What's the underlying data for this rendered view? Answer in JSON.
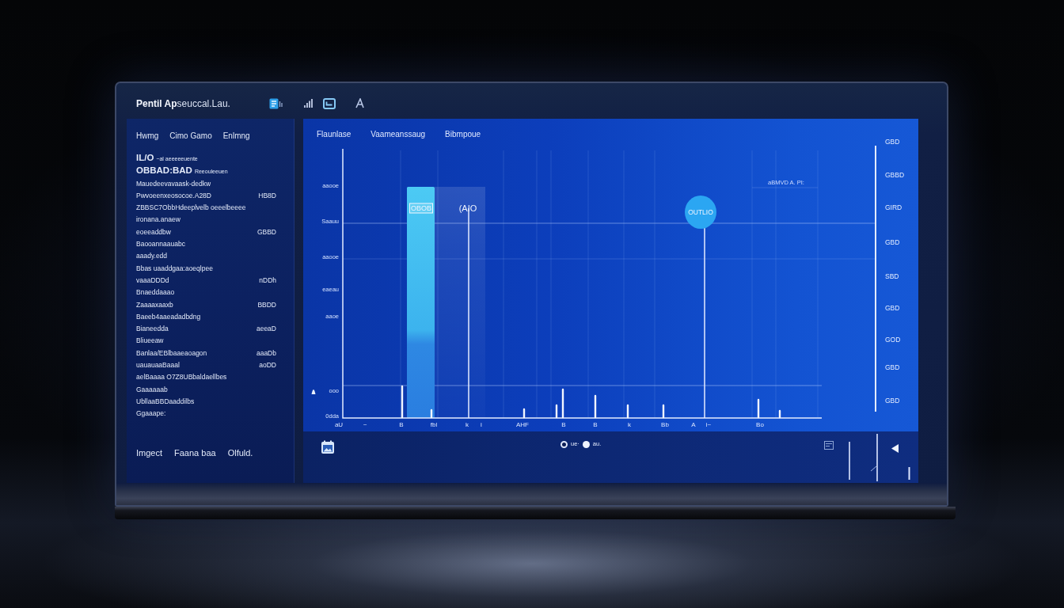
{
  "window": {
    "title": "**Pentil Ap**seuccal.Lau."
  },
  "sidebar": {
    "menu": [
      "Hwmg",
      "Cimo Gamo",
      "Enlmng"
    ],
    "rows": [
      {
        "label": "IL/O",
        "detail": "~al aeeeeeuente"
      },
      {
        "label": "OBBAD:BAD",
        "detail": "Reeouleeuen"
      },
      {
        "label": "Mauedeevavaask-dedkw"
      },
      {
        "label": "Pwvoeenxeosocoe.A28D",
        "value": "HB8D"
      },
      {
        "label": "ZBBSC7ObbHdeeplvelb oeeelbeeee"
      },
      {
        "label": "ironana.anaew"
      },
      {
        "label": "eoeeaddbw",
        "value": "GBBD"
      },
      {
        "label": "Baooannaauabc"
      },
      {
        "label": "aaady.edd"
      },
      {
        "label": "Bbas uaaddgaa:aoeqlpee"
      },
      {
        "label": "vaaaDDDd",
        "value": "nDDh"
      },
      {
        "label": "Bnaeddaaao"
      },
      {
        "label": "Zaaaaxaaxb",
        "value": "BBDD"
      },
      {
        "label": "Baeeb4aaeadadbdng"
      },
      {
        "label": "Bianeedda",
        "value": "aeeaD"
      },
      {
        "label": "Bliueeaw"
      },
      {
        "label": "Banlaa/EBlbaaeaoagon",
        "value": "aaaDb"
      },
      {
        "label": "uauauaaBaaal",
        "value": "aoDD"
      },
      {
        "label": "aelBaaaa O7Z8UBbaldaellbes"
      },
      {
        "label": "Gaaaaaab"
      },
      {
        "label": "UbllaaBBDaaddilbs"
      },
      {
        "label": "Ggaaape:"
      }
    ],
    "footer_links": [
      "Imgect",
      "Faana baa",
      "Olfuld."
    ]
  },
  "chart_panel": {
    "headings": [
      "Flaunlase",
      "Vaameanssaug",
      "Bibmpoue"
    ],
    "left_axis_labels": [
      "aaooe",
      "Saauu",
      "aaooe",
      "eaeau",
      "aaoe",
      "ooo",
      "0dda"
    ],
    "right_axis_labels": [
      "GBD",
      "GBBD",
      "GIRD",
      "GBD",
      "SBD",
      "GBD",
      "GOD",
      "GBD",
      "GBD"
    ],
    "x_axis_labels": [
      "aU",
      "~",
      "B",
      "fbl",
      "k",
      "i",
      "AHF",
      "B",
      "B",
      "k",
      "Bb",
      "A",
      "i~",
      "Bo"
    ],
    "annotations": [
      {
        "text": "OBOB",
        "kind": "boxed"
      },
      {
        "text": "(AIO",
        "kind": "label"
      },
      {
        "text": "OUTLIO",
        "kind": "bubble"
      },
      {
        "text": "aBMVD A. PI:",
        "kind": "note"
      }
    ]
  },
  "bottom_bar": {
    "legend": [
      {
        "label": "ue·",
        "kind": "ring"
      },
      {
        "label": "au.",
        "kind": "dot"
      }
    ]
  }
}
